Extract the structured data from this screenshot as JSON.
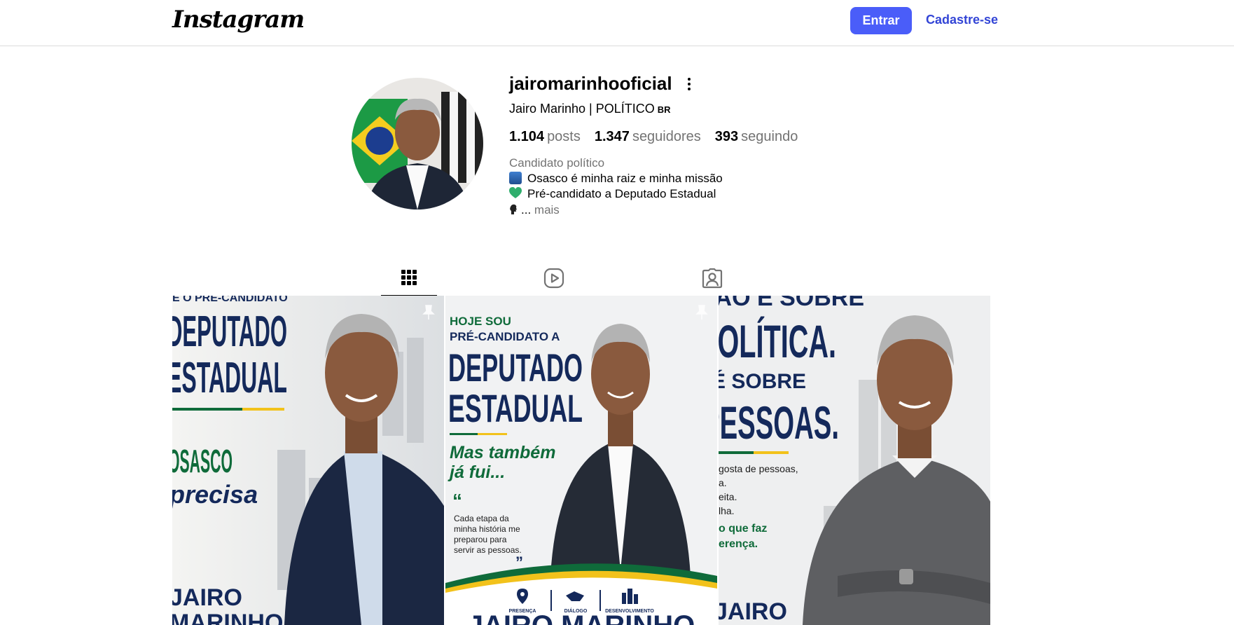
{
  "nav": {
    "logo": "Instagram",
    "login_label": "Entrar",
    "signup_label": "Cadastre-se"
  },
  "profile": {
    "username": "jairomarinhooficial",
    "full_name": "Jairo Marinho | POLÍTICO",
    "country_badge": "BR",
    "stats": {
      "posts_count": "1.104",
      "posts_label": "posts",
      "followers_count": "1.347",
      "followers_label": "seguidores",
      "following_count": "393",
      "following_label": "seguindo"
    },
    "category": "Candidato político",
    "bio": [
      "Osasco é minha raiz e minha missão",
      "Pré-candidato a Deputado Estadual",
      "..."
    ],
    "bio_more": "mais"
  },
  "tabs": [
    {
      "name": "posts",
      "icon": "grid-icon",
      "active": true
    },
    {
      "name": "reels",
      "icon": "reels-icon",
      "active": false
    },
    {
      "name": "tagged",
      "icon": "tagged-icon",
      "active": false
    }
  ],
  "posts": [
    {
      "pinned": true,
      "text": [
        "É O PRÉ-CANDIDATO",
        "DEPUTADO",
        "ESTADUAL",
        "OSASCO",
        "precisa",
        "JAIRO",
        "MARINHO"
      ]
    },
    {
      "pinned": true,
      "text": [
        "HOJE SOU",
        "PRÉ-CANDIDATO A",
        "DEPUTADO",
        "ESTADUAL",
        "Mas também",
        "já fui...",
        "Cada etapa da",
        "minha história me",
        "preparou para",
        "servir as pessoas.",
        "PRESENÇA",
        "DIÁLOGO",
        "DESENVOLVIMENTO",
        "JAIRO MARINHO"
      ]
    },
    {
      "pinned": false,
      "text": [
        "NÃO É SOBRE",
        "POLÍTICA.",
        "É SOBRE",
        "PESSOAS.",
        "gosta de pessoas,",
        "a.",
        "eita.",
        "lha.",
        "o que faz",
        "erença.",
        "JAIRO"
      ]
    }
  ],
  "colors": {
    "accent": "#4a5df9",
    "link": "#3345d6",
    "navy": "#14295b",
    "green": "#0f6b3a",
    "yellow": "#f2c21b"
  }
}
